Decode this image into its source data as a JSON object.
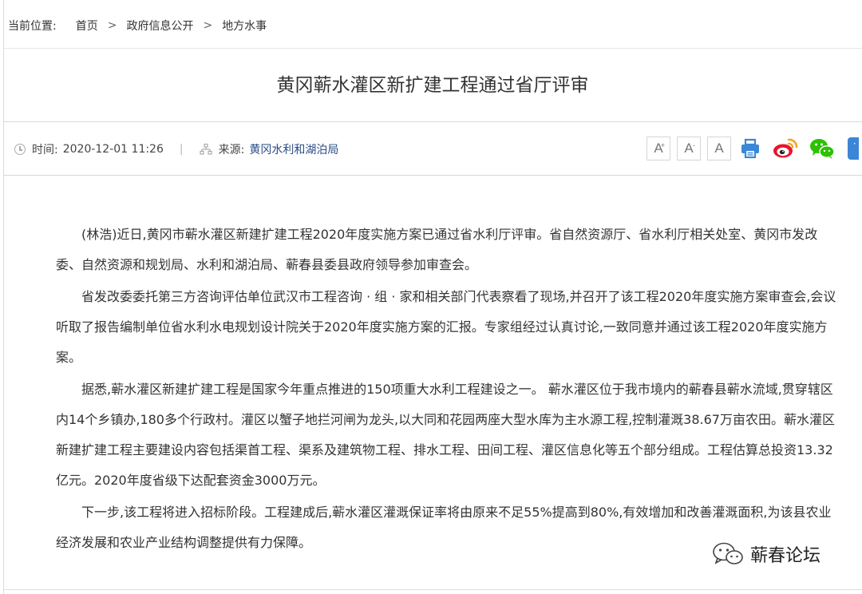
{
  "breadcrumb": {
    "label": "当前位置:",
    "items": [
      "首页",
      "政府信息公开",
      "地方水事"
    ],
    "separator": ">"
  },
  "article": {
    "title": "黄冈蕲水灌区新扩建工程通过省厅评审",
    "time_label": "时间:",
    "time_value": "2020-12-01 11:26",
    "divider": "|",
    "source_label": "来源:",
    "source_value": "黄冈水利和湖泊局",
    "paragraphs": [
      "(林浩)近日,黄冈市蕲水灌区新建扩建工程2020年度实施方案已通过省水利厅评审。省自然资源厅、省水利厅相关处室、黄冈市发改委、自然资源和规划局、水利和湖泊局、蕲春县委县政府领导参加审查会。",
      "省发改委委托第三方咨询评估单位武汉市工程咨询  ·  组  ·  家和相关部门代表察看了现场,并召开了该工程2020年度实施方案审查会,会议听取了报告编制单位省水利水电规划设计院关于2020年度实施方案的汇报。专家组经过认真讨论,一致同意并通过该工程2020年度实施方案。",
      "据悉,蕲水灌区新建扩建工程是国家今年重点推进的150项重大水利工程建设之一。 蕲水灌区位于我市境内的蕲春县蕲水流域,贯穿辖区内14个乡镇办,180多个行政村。灌区以蟹子地拦河闸为龙头,以大同和花园两座大型水库为主水源工程,控制灌溉38.67万亩农田。蕲水灌区新建扩建工程主要建设内容包括渠首工程、渠系及建筑物工程、排水工程、田间工程、灌区信息化等五个部分组成。工程估算总投资13.32亿元。2020年度省级下达配套资金3000万元。",
      "下一步,该工程将进入招标阶段。工程建成后,蕲水灌区灌溉保证率将由原来不足55%提高到80%,有效增加和改善灌溉面积,为该县农业经济发展和农业产业结构调整提供有力保障。"
    ]
  },
  "tools": {
    "font_large": "A",
    "font_large_mark": "+",
    "font_small": "A",
    "font_small_mark": "-",
    "font_default": "A"
  },
  "icons": {
    "time": "clock-icon",
    "source": "sitemap-icon",
    "print": "printer-icon",
    "weibo": "weibo-icon",
    "wechat": "wechat-icon",
    "more": "more-icon"
  },
  "watermark": {
    "text": "蕲春论坛"
  },
  "colors": {
    "accent_blue": "#2b4c86",
    "print_blue": "#3b86d6",
    "weibo_red": "#e6162d",
    "weibo_orange": "#f5a623",
    "wechat_green": "#2dc100"
  }
}
